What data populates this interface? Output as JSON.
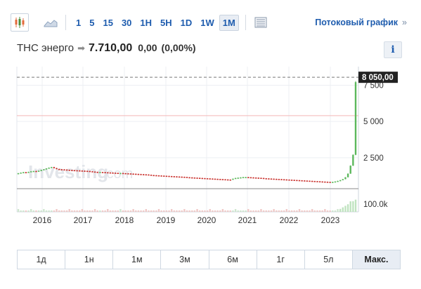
{
  "toolbar": {
    "icons": [
      "candlestick-icon",
      "area-chart-icon",
      "table-icon"
    ],
    "timeframes": [
      "1",
      "5",
      "15",
      "30",
      "1H",
      "5H",
      "1D",
      "1W",
      "1M"
    ],
    "active_timeframe": "1M",
    "stream_label": "Потоковый график",
    "stream_chevron": "»"
  },
  "quote": {
    "name": "ТНС энерго",
    "arrow": "➡",
    "price": "7.710,00",
    "change": "0,00",
    "change_pct": "(0,00%)",
    "info_label": "i"
  },
  "chart_data": {
    "type": "candlestick",
    "watermark": "Investing",
    "watermark_suffix": ".com",
    "x_labels": [
      "2016",
      "2017",
      "2018",
      "2019",
      "2020",
      "2021",
      "2022",
      "2023"
    ],
    "y_tick_labels": [
      "7 500",
      "5 000",
      "2 500"
    ],
    "y_ticks": [
      7500,
      5000,
      2500
    ],
    "current_price_label": "8 050,00",
    "current_price": 8050,
    "volume_label": "100.0k",
    "colors": {
      "up": "#5cb85c",
      "down": "#c9302c",
      "grid": "#eceff3",
      "dashed": "#777777",
      "redline": "#f3b8b8",
      "volume": "#d9dde3"
    },
    "monthly_close": [
      1430,
      1470,
      1500,
      1490,
      1520,
      1560,
      1580,
      1540,
      1600,
      1650,
      1700,
      1760,
      1810,
      1850,
      1780,
      1720,
      1700,
      1690,
      1680,
      1660,
      1650,
      1640,
      1630,
      1620,
      1610,
      1600,
      1590,
      1580,
      1560,
      1540,
      1520,
      1500,
      1510,
      1500,
      1490,
      1480,
      1470,
      1460,
      1450,
      1440,
      1440,
      1430,
      1420,
      1410,
      1400,
      1390,
      1380,
      1370,
      1360,
      1350,
      1340,
      1320,
      1300,
      1290,
      1280,
      1270,
      1260,
      1250,
      1240,
      1230,
      1220,
      1210,
      1200,
      1190,
      1180,
      1170,
      1150,
      1140,
      1130,
      1120,
      1110,
      1100,
      1090,
      1080,
      1070,
      1060,
      1050,
      1040,
      1030,
      1020,
      1010,
      1000,
      990,
      980,
      1050,
      1100,
      1120,
      1140,
      1160,
      1160,
      1150,
      1140,
      1130,
      1120,
      1110,
      1100,
      1080,
      1070,
      1060,
      1050,
      1040,
      1030,
      1020,
      1010,
      1000,
      990,
      980,
      970,
      960,
      950,
      940,
      930,
      920,
      910,
      900,
      890,
      880,
      870,
      860,
      850,
      840,
      830,
      820,
      830,
      860,
      900,
      950,
      1020,
      1150,
      1400,
      1950,
      2700,
      7710
    ]
  },
  "ranges": {
    "items": [
      "1д",
      "1н",
      "1м",
      "3м",
      "6м",
      "1г",
      "5л",
      "Макс."
    ],
    "active": "Макс."
  }
}
